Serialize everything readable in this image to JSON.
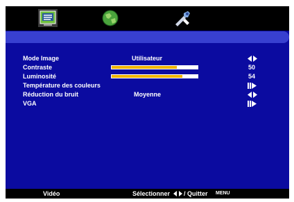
{
  "tabs": [
    {
      "icon": "picture-monitor-icon",
      "selected": true
    },
    {
      "icon": "sound-globe-icon",
      "selected": false
    },
    {
      "icon": "tools-wrench-icon",
      "selected": false
    }
  ],
  "menu": {
    "rows": [
      {
        "label": "Mode Image",
        "value": "Utilisateur",
        "control": "left-right-arrows-icon"
      },
      {
        "label": "Contraste",
        "level": 50,
        "num": "50"
      },
      {
        "label": "Luminosité",
        "level": 54,
        "num": "54"
      },
      {
        "label": "Température des couleurs",
        "control": "enter-submenu-icon"
      },
      {
        "label": "Réduction du bruit",
        "value": "Moyenne",
        "control": "left-right-arrows-icon"
      },
      {
        "label": "VGA",
        "control": "enter-submenu-icon"
      }
    ]
  },
  "footer": {
    "video": "Vidéo",
    "select": "Sélectionner",
    "quit": "/ Quitter",
    "menu": "MENU"
  },
  "colors": {
    "accent": "#3840d0",
    "bar_fill": "#f0b400",
    "background": "#00007c"
  }
}
